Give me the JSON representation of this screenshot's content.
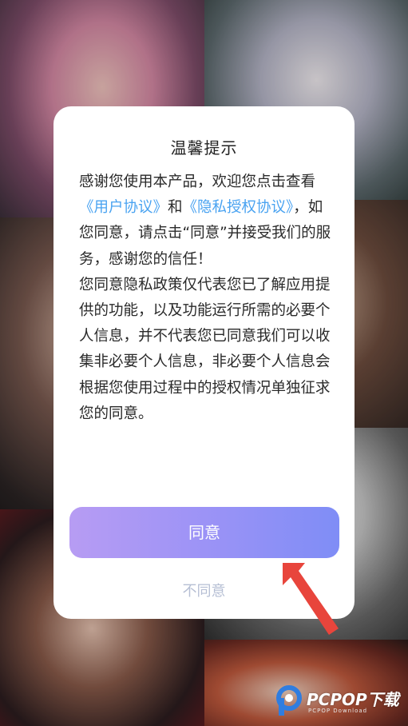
{
  "dialog": {
    "title": "温馨提示",
    "body": {
      "intro_prefix": "感谢您使用本产品，欢迎您点击查看",
      "user_agreement_link": "《用户协议》",
      "conjunction": "和",
      "privacy_link": "《隐私授权协议》",
      "intro_suffix": "，如您同意，请点击“同意”并接受我们的服务，感谢您的信任！",
      "paragraph2": "您同意隐私政策仅代表您已了解应用提供的功能，以及功能运行所需的必要个人信息，并不代表您已同意我们可以收集非必要个人信息，非必要个人信息会根据您使用过程中的授权情况单独征求您的同意。"
    },
    "agree_label": "同意",
    "disagree_label": "不同意"
  },
  "watermark": {
    "text": "PCPOP下载",
    "subtext": "PCPOP Download"
  },
  "colors": {
    "link": "#4aa3f1",
    "agree_gradient_start": "#b79cf3",
    "agree_gradient_end": "#7f8df6",
    "disagree_text": "#b6bfd4",
    "arrow": "#e8453c"
  }
}
